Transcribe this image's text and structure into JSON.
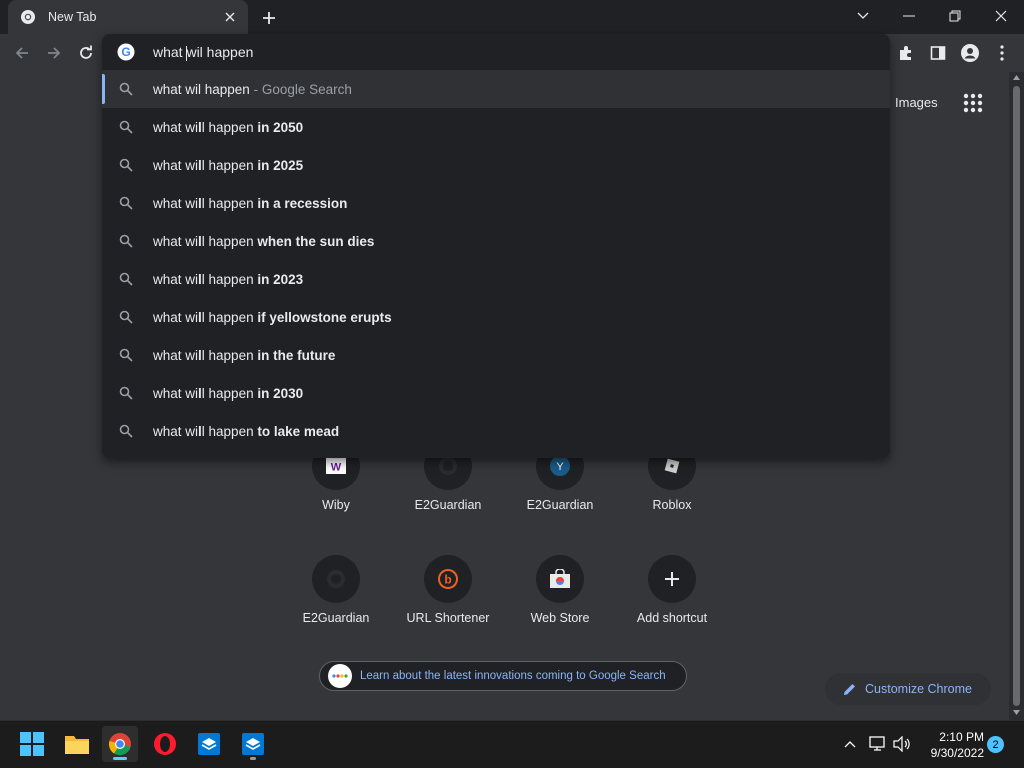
{
  "browser": {
    "tab": {
      "title": "New Tab"
    },
    "omnibox": {
      "input_value": "what wil happen",
      "suggestions": [
        {
          "prefix": "what wil happen",
          "bold": "",
          "suffix": " - Google Search",
          "selected": true
        },
        {
          "prefix": "what wi",
          "bold1": "l",
          "mid": "l happen ",
          "bold": "in 2050"
        },
        {
          "prefix": "what wi",
          "bold1": "l",
          "mid": "l happen ",
          "bold": "in 2025"
        },
        {
          "prefix": "what wi",
          "bold1": "l",
          "mid": "l happen ",
          "bold": "in a recession"
        },
        {
          "prefix": "what wi",
          "bold1": "l",
          "mid": "l happen ",
          "bold": "when the sun dies"
        },
        {
          "prefix": "what wi",
          "bold1": "l",
          "mid": "l happen ",
          "bold": "in 2023"
        },
        {
          "prefix": "what wi",
          "bold1": "l",
          "mid": "l happen ",
          "bold": "if yellowstone erupts"
        },
        {
          "prefix": "what wi",
          "bold1": "l",
          "mid": "l happen ",
          "bold": "in the future"
        },
        {
          "prefix": "what wi",
          "bold1": "l",
          "mid": "l happen ",
          "bold": "in 2030"
        },
        {
          "prefix": "what wi",
          "bold1": "l",
          "mid": "l happen ",
          "bold": "to lake mead"
        }
      ]
    }
  },
  "page": {
    "images_link": "Images",
    "shortcuts_row1": [
      "Wiby",
      "E2Guardian",
      "E2Guardian",
      "Roblox"
    ],
    "shortcuts_row2": [
      "E2Guardian",
      "URL Shortener",
      "Web Store",
      "Add shortcut"
    ],
    "promo_text": "Learn about the latest innovations coming to Google Search",
    "customize_label": "Customize Chrome"
  },
  "taskbar": {
    "time": "2:10 PM",
    "date": "9/30/2022",
    "notification_count": "2"
  },
  "colors": {
    "accent_blue": "#8ab4f8",
    "background": "#35363a",
    "omnibox_bg": "#202124"
  }
}
